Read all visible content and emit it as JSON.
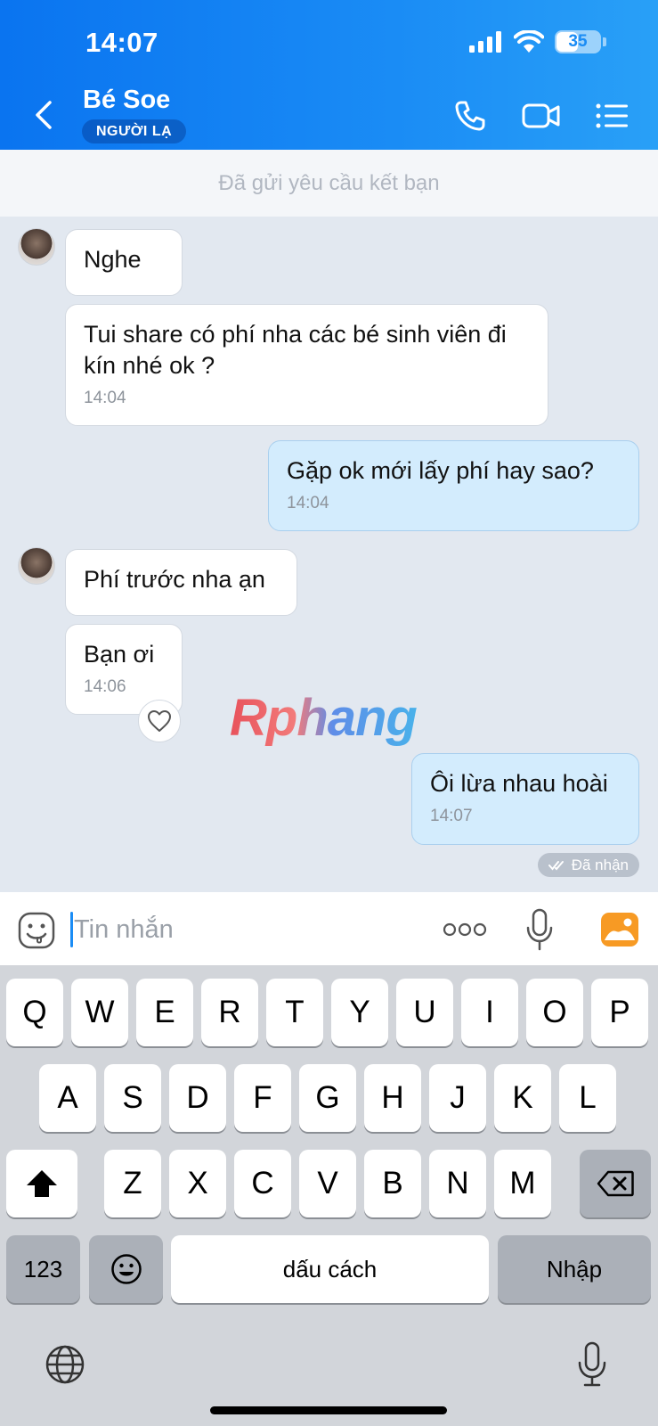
{
  "status_bar": {
    "time": "14:07",
    "battery": "35"
  },
  "header": {
    "contact_name": "Bé Soe",
    "badge": "NGƯỜI LẠ"
  },
  "banner": {
    "text": "Đã gửi yêu cầu kết bạn"
  },
  "messages": [
    {
      "side": "in",
      "text": "Nghe",
      "time": ""
    },
    {
      "side": "in",
      "text": "Tui share có phí nha các bé sinh viên đi kín nhé ok ?",
      "time": "14:04"
    },
    {
      "side": "out",
      "text": "Gặp ok mới lấy phí hay sao?",
      "time": "14:04"
    },
    {
      "side": "in",
      "text": "Phí trước nha ạn",
      "time": ""
    },
    {
      "side": "in",
      "text": "Bạn ơi",
      "time": "14:06"
    },
    {
      "side": "out",
      "text": "Ôi lừa nhau hoài",
      "time": "14:07"
    }
  ],
  "watermark": "Rphang",
  "read_receipt": "Đã nhận",
  "composer": {
    "placeholder": "Tin nhắn"
  },
  "keyboard": {
    "row1": [
      "Q",
      "W",
      "E",
      "R",
      "T",
      "Y",
      "U",
      "I",
      "O",
      "P"
    ],
    "row2": [
      "A",
      "S",
      "D",
      "F",
      "G",
      "H",
      "J",
      "K",
      "L"
    ],
    "row3": [
      "Z",
      "X",
      "C",
      "V",
      "B",
      "N",
      "M"
    ],
    "numbers_key": "123",
    "space_key": "dấu cách",
    "return_key": "Nhập"
  },
  "colors": {
    "header_start": "#0a74f0",
    "header_end": "#29a0f7",
    "outgoing_bubble": "#d3ecfd",
    "chat_bg": "#e2e8f0"
  }
}
